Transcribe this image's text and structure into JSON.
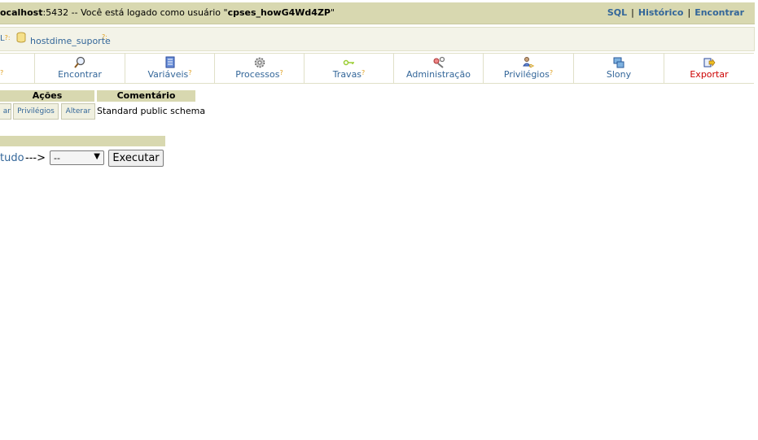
{
  "topbar": {
    "host": "ocalhost",
    "port_text": ":5432 -- Você está logado como usuário \"",
    "user": "cpses_howG4Wd4ZP",
    "close_quote": "\"",
    "links": [
      "SQL",
      "Histórico",
      "Encontrar"
    ]
  },
  "trail": {
    "fragment": "L",
    "fragment_q": "?:",
    "database": "hostdime_suporte",
    "database_q": "?:"
  },
  "tabs": [
    {
      "label": "?",
      "icon": "cut-off-icon"
    },
    {
      "label": "Encontrar",
      "icon": "magnifier-icon"
    },
    {
      "label": "Variáveis",
      "help": "?",
      "icon": "list-icon"
    },
    {
      "label": "Processos",
      "help": "?",
      "icon": "gear-icon"
    },
    {
      "label": "Travas",
      "help": "?",
      "icon": "key-icon"
    },
    {
      "label": "Administração",
      "icon": "wrench-icon"
    },
    {
      "label": "Privilégios",
      "help": "?",
      "icon": "user-key-icon"
    },
    {
      "label": "Slony",
      "icon": "slony-icon"
    },
    {
      "label": "Exportar",
      "icon": "export-icon"
    }
  ],
  "table": {
    "headers": {
      "actions": "Ações",
      "comment": "Comentário"
    },
    "row": {
      "btn_cut": "ar",
      "btn_privileges": "Privilégios",
      "btn_alter": "Alterar",
      "comment": "Standard public schema"
    }
  },
  "actionbar": {
    "select_all": "tudo",
    "arrow": "--->",
    "select_value": "--",
    "execute": "Executar"
  }
}
